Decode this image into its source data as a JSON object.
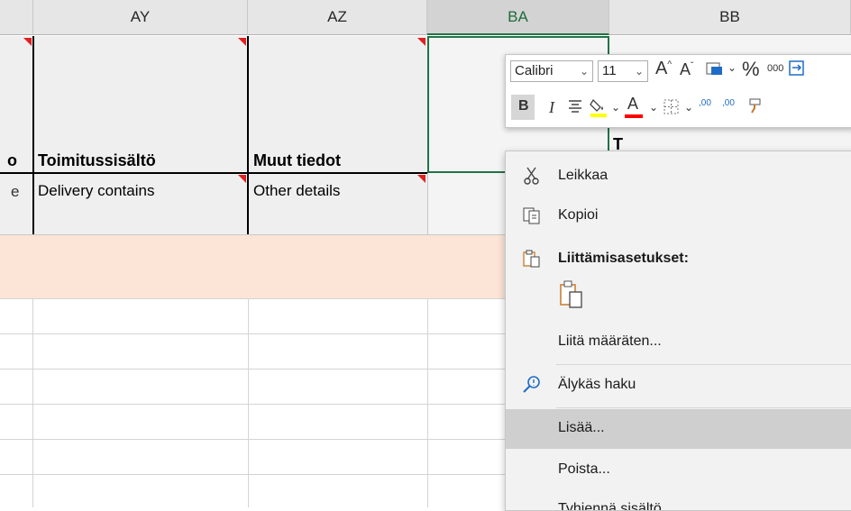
{
  "columns": [
    {
      "label": "AY"
    },
    {
      "label": "AZ"
    },
    {
      "label": "BA"
    },
    {
      "label": "BB"
    }
  ],
  "cells": {
    "cut_text_left": "o",
    "cut_text_left2": "e",
    "ay_header": "Toimitussisältö",
    "ay_sub": "Delivery contains",
    "az_header": "Muut tiedot",
    "az_sub": "Other details",
    "ba_partial": "T"
  },
  "mini_toolbar": {
    "font_name": "Calibri",
    "font_size": "11",
    "grow_font": "A",
    "shrink_font": "A",
    "percent": "%",
    "thousands": "000",
    "bold": "B",
    "italic": "I",
    "font_color_letter": "A",
    "inc_decimal": ",00",
    "dec_decimal": ",00",
    "colors": {
      "highlight": "#ffff00",
      "font": "#ff0000"
    }
  },
  "context_menu": {
    "items": [
      {
        "label": "Leikkaa",
        "icon": "scissors-icon"
      },
      {
        "label": "Kopioi",
        "icon": "copy-icon"
      },
      {
        "label": "Liittämisasetukset:",
        "icon": "paste-icon"
      },
      {
        "label": "Liitä määräten...",
        "icon": ""
      },
      {
        "label": "Älykäs haku",
        "icon": "smart-lookup-icon"
      },
      {
        "label": "Lisää...",
        "icon": ""
      },
      {
        "label": "Poista...",
        "icon": ""
      },
      {
        "label": "Tyhjennä sisältö",
        "icon": ""
      }
    ]
  },
  "colors": {
    "accent": "#217346",
    "pink_row": "#fce4d6",
    "comment_marker": "#e02020"
  }
}
